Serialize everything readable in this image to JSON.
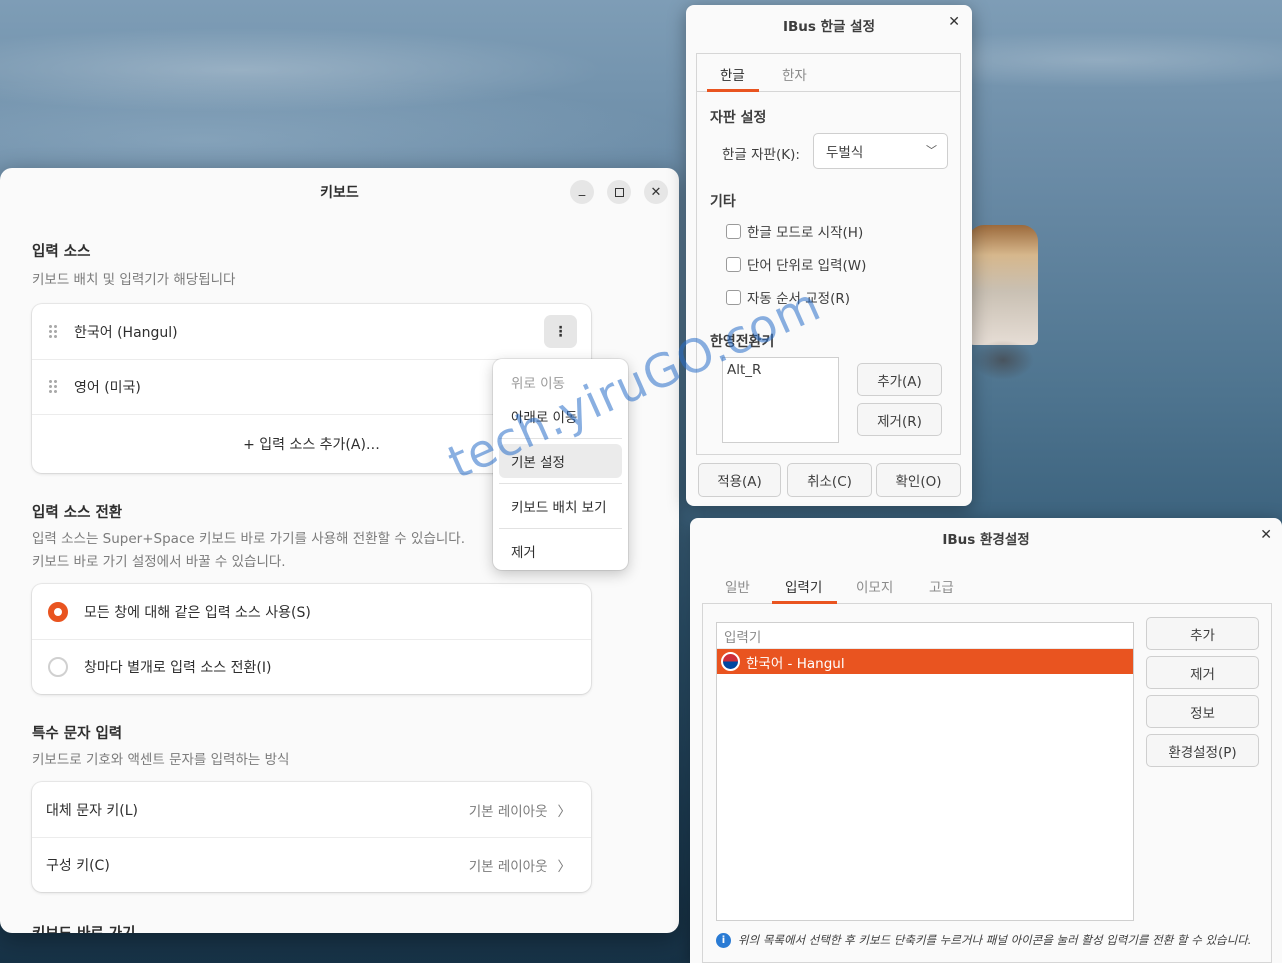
{
  "keyboard": {
    "title": "키보드",
    "input_sources": {
      "title": "입력 소스",
      "subtitle": "키보드 배치 및 입력기가 해당됩니다",
      "items": [
        {
          "label": "한국어 (Hangul)"
        },
        {
          "label": "영어 (미국)"
        }
      ],
      "add_label": "+ 입력 소스 추가(A)…",
      "menu_icon": "⋮"
    },
    "context_menu": {
      "move_up": "위로 이동",
      "move_down": "아래로 이동",
      "preferences": "기본 설정",
      "view_layout": "키보드 배치 보기",
      "remove": "제거"
    },
    "switching": {
      "title": "입력 소스 전환",
      "subtitle_1": "입력 소스는 Super+Space 키보드 바로 가기를 사용해 전환할 수 있습니다.",
      "subtitle_2": "키보드 바로 가기 설정에서 바꿀 수 있습니다.",
      "options": [
        {
          "label": "모든 창에 대해 같은 입력 소스 사용(S)",
          "selected": true
        },
        {
          "label": "창마다 별개로 입력 소스 전환(I)",
          "selected": false
        }
      ]
    },
    "special_chars": {
      "title": "특수 문자 입력",
      "subtitle": "키보드로 기호와 액센트 문자를 입력하는 방식",
      "items": [
        {
          "label": "대체 문자 키(L)",
          "value": "기본 레이아웃"
        },
        {
          "label": "구성 키(C)",
          "value": "기본 레이아웃"
        }
      ]
    },
    "shortcuts": {
      "title": "키보드 바로 가기"
    }
  },
  "hangul_setup": {
    "title": "IBus 한글 설정",
    "tabs": [
      "한글",
      "한자"
    ],
    "active_tab": 0,
    "layout_group": "자판 설정",
    "layout_label": "한글 자판(K):",
    "layout_value": "두벌식",
    "misc_group": "기타",
    "checkboxes": [
      {
        "label": "한글 모드로 시작(H)",
        "checked": false
      },
      {
        "label": "단어 단위로 입력(W)",
        "checked": false
      },
      {
        "label": "자동 순서 교정(R)",
        "checked": false
      }
    ],
    "toggle_group": "한영전환키",
    "toggle_keys": [
      "Alt_R"
    ],
    "add_button": "추가(A)",
    "remove_button": "제거(R)",
    "apply_button": "적용(A)",
    "cancel_button": "취소(C)",
    "ok_button": "확인(O)"
  },
  "ibus_prefs": {
    "title": "IBus 환경설정",
    "tabs": [
      "일반",
      "입력기",
      "이모지",
      "고급"
    ],
    "active_tab": 1,
    "list_header": "입력기",
    "engines": [
      {
        "label": "한국어 - Hangul",
        "selected": true
      }
    ],
    "buttons": [
      "추가",
      "제거",
      "정보",
      "환경설정(P)"
    ],
    "info_text": "위의 목록에서 선택한 후 키보드 단축키를 누르거나 패널 아이콘을 눌러 활성 입력기를 전환 할 수 있습니다."
  },
  "watermark": "tech.yiruGO.com",
  "colors": {
    "accent": "#e95420",
    "info": "#2a7bd4"
  }
}
